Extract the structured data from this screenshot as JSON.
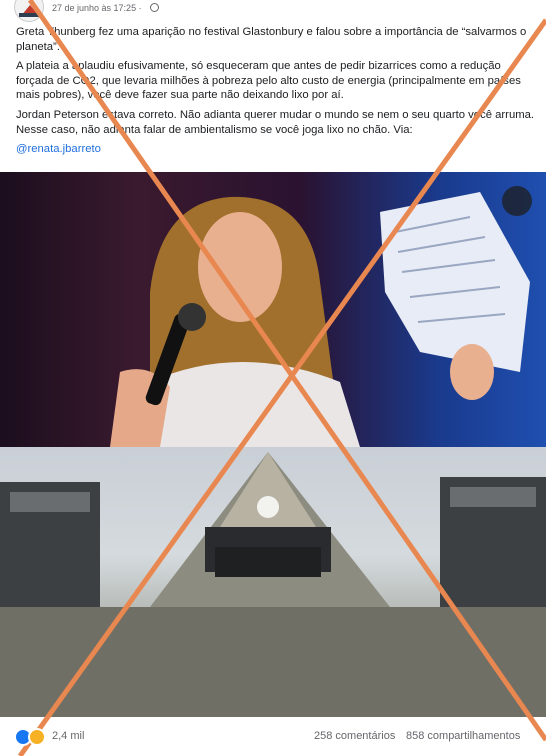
{
  "post": {
    "timestamp": "27 de junho às 17:25 ·",
    "paragraphs": [
      "Greta Thunberg fez uma aparição no festival Glastonbury e falou sobre a importância de “salvarmos o planeta”.",
      "A plateia a aplaudiu efusivamente, só esqueceram que antes de pedir bizarrices como a redução forçada de CO2, que levaria milhões à pobreza pelo alto custo de energia (principalmente em países mais pobres), você deve fazer sua parte não deixando lixo por aí.",
      "Jordan Peterson estava correto. Não adianta querer mudar o mundo se nem o seu quarto você arruma. Nesse caso, não adianta falar de ambientalismo se você joga lixo no chão. Via:"
    ],
    "mention": "@renata.jbarreto"
  },
  "footer": {
    "reaction_count": "2,4 mil",
    "comments": "258 comentários",
    "shares": "858 compartilhamentos"
  },
  "colors": {
    "cross": "#e8874f",
    "link": "#216fdb",
    "like": "#1877f2"
  },
  "icons": {
    "visibility": "eye-icon",
    "privacy": "globe-icon"
  }
}
